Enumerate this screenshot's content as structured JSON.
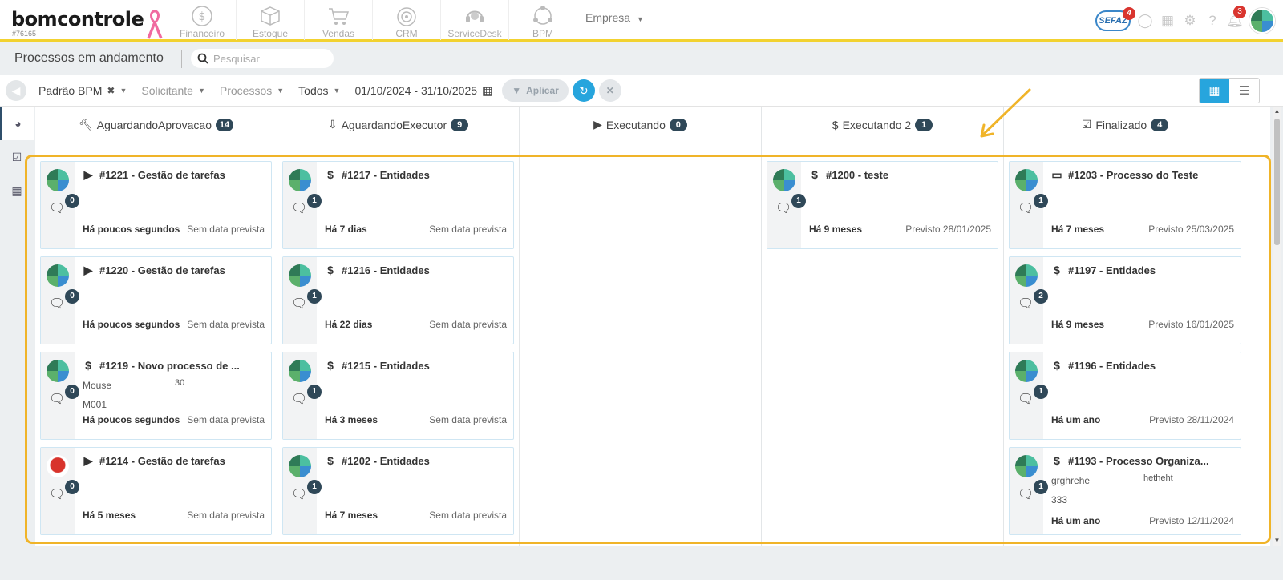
{
  "app": {
    "logo": "bomcontrole",
    "account_id": "#76165"
  },
  "modules": [
    {
      "label": "Financeiro",
      "icon": "dollar-circle-icon"
    },
    {
      "label": "Estoque",
      "icon": "box-icon"
    },
    {
      "label": "Vendas",
      "icon": "cart-icon"
    },
    {
      "label": "CRM",
      "icon": "target-icon"
    },
    {
      "label": "ServiceDesk",
      "icon": "headset-icon"
    },
    {
      "label": "BPM",
      "icon": "network-icon"
    }
  ],
  "company_selector": "Empresa",
  "topright": {
    "sefaz_label": "SEFAZ",
    "sefaz_badge": "4",
    "notifications_badge": "3"
  },
  "page": {
    "title": "Processos em andamento",
    "search_placeholder": "Pesquisar"
  },
  "filters": {
    "view_filter": "Padrão BPM",
    "requester": "Solicitante",
    "processes": "Processos",
    "status": "Todos",
    "date_range": "01/10/2024 - 31/10/2025",
    "apply_label": "Aplicar"
  },
  "columns": [
    {
      "name": "AguardandoAprovacao",
      "count": "14",
      "icon": "gavel-icon",
      "cards": [
        {
          "type_icon": "play-circle-icon",
          "title": "#1221 - Gestão de tarefas",
          "comments": "0",
          "age": "Há poucos segundos",
          "due": "Sem data prevista",
          "avatar": "globe"
        },
        {
          "type_icon": "play-circle-icon",
          "title": "#1220 - Gestão de tarefas",
          "comments": "0",
          "age": "Há poucos segundos",
          "due": "Sem data prevista",
          "avatar": "globe"
        },
        {
          "type_icon": "dollar-icon",
          "title": "#1219 - Novo processo de ...",
          "comments": "0",
          "age": "Há poucos segundos",
          "due": "Sem data prevista",
          "avatar": "globe",
          "extra": [
            "Mouse",
            "30",
            "M001"
          ]
        },
        {
          "type_icon": "play-circle-icon",
          "title": "#1214 - Gestão de tarefas",
          "comments": "0",
          "age": "Há 5 meses",
          "due": "Sem data prevista",
          "avatar": "robot"
        }
      ]
    },
    {
      "name": "AguardandoExecutor",
      "count": "9",
      "icon": "person-down-icon",
      "cards": [
        {
          "type_icon": "dollar-icon",
          "title": "#1217 - Entidades",
          "comments": "1",
          "age": "Há 7 dias",
          "due": "Sem data prevista",
          "avatar": "globe"
        },
        {
          "type_icon": "dollar-icon",
          "title": "#1216 - Entidades",
          "comments": "1",
          "age": "Há 22 dias",
          "due": "Sem data prevista",
          "avatar": "globe"
        },
        {
          "type_icon": "dollar-icon",
          "title": "#1215 - Entidades",
          "comments": "1",
          "age": "Há 3 meses",
          "due": "Sem data prevista",
          "avatar": "globe"
        },
        {
          "type_icon": "dollar-icon",
          "title": "#1202 - Entidades",
          "comments": "1",
          "age": "Há 7 meses",
          "due": "Sem data prevista",
          "avatar": "globe"
        }
      ]
    },
    {
      "name": "Executando",
      "count": "0",
      "icon": "play-circle-icon",
      "cards": []
    },
    {
      "name": "Executando 2",
      "count": "1",
      "icon": "dollar-icon",
      "cards": [
        {
          "type_icon": "dollar-icon",
          "title": "#1200 - teste",
          "comments": "1",
          "age": "Há 9 meses",
          "due": "Previsto 28/01/2025",
          "avatar": "globe"
        }
      ]
    },
    {
      "name": "Finalizado",
      "count": "4",
      "icon": "check-square-icon",
      "cards": [
        {
          "type_icon": "battery-icon",
          "title": "#1203 - Processo do Teste",
          "comments": "1",
          "age": "Há 7 meses",
          "due": "Previsto 25/03/2025",
          "avatar": "globe"
        },
        {
          "type_icon": "dollar-icon",
          "title": "#1197 - Entidades",
          "comments": "2",
          "age": "Há 9 meses",
          "due": "Previsto 16/01/2025",
          "avatar": "globe"
        },
        {
          "type_icon": "dollar-icon",
          "title": "#1196 - Entidades",
          "comments": "1",
          "age": "Há um ano",
          "due": "Previsto 28/11/2024",
          "avatar": "globe"
        },
        {
          "type_icon": "dollar-icon",
          "title": "#1193 - Processo Organiza...",
          "comments": "1",
          "age": "Há um ano",
          "due": "Previsto 12/11/2024",
          "avatar": "globe",
          "extra": [
            "grghrehe",
            "hetheht",
            "333"
          ]
        }
      ]
    }
  ],
  "colors": {
    "accent_yellow": "#f2d230",
    "highlight": "#f0b429",
    "primary_blue": "#27a5dd",
    "count_badge": "#2f4858",
    "badge_red": "#d9352f"
  }
}
